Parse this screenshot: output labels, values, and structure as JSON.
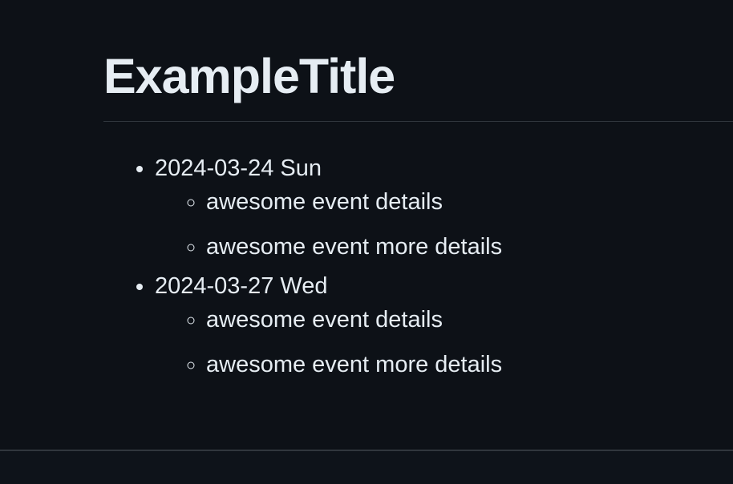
{
  "document": {
    "title": "ExampleTitle",
    "days": [
      {
        "date": "2024-03-24 Sun",
        "events": [
          "awesome event details",
          "awesome event more details"
        ]
      },
      {
        "date": "2024-03-27 Wed",
        "events": [
          "awesome event details",
          "awesome event more details"
        ]
      }
    ]
  },
  "colors": {
    "background": "#0d1117",
    "text": "#e6edf3",
    "divider": "#30363d"
  }
}
